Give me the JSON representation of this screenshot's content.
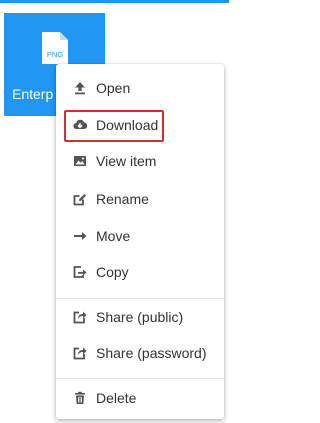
{
  "file": {
    "name": "Enterp",
    "badge": "PNG",
    "tile_color": "#2196f3",
    "icon": "png-file-icon"
  },
  "context_menu": {
    "items": [
      {
        "label": "Open",
        "icon": "upload-icon"
      },
      {
        "label": "Download",
        "icon": "cloud-download-icon",
        "highlighted": true
      },
      {
        "label": "View item",
        "icon": "image-icon"
      },
      {
        "label": "Rename",
        "icon": "edit-icon"
      },
      {
        "label": "Move",
        "icon": "arrow-right-icon"
      },
      {
        "label": "Copy",
        "icon": "copy-icon"
      },
      {
        "label": "Share (public)",
        "icon": "share-icon"
      },
      {
        "label": "Share (password)",
        "icon": "share-icon"
      },
      {
        "label": "Delete",
        "icon": "trash-icon"
      }
    ]
  },
  "colors": {
    "accent": "#2196f3",
    "highlight": "#d32f2f",
    "icon": "#555555",
    "text": "#333333"
  }
}
